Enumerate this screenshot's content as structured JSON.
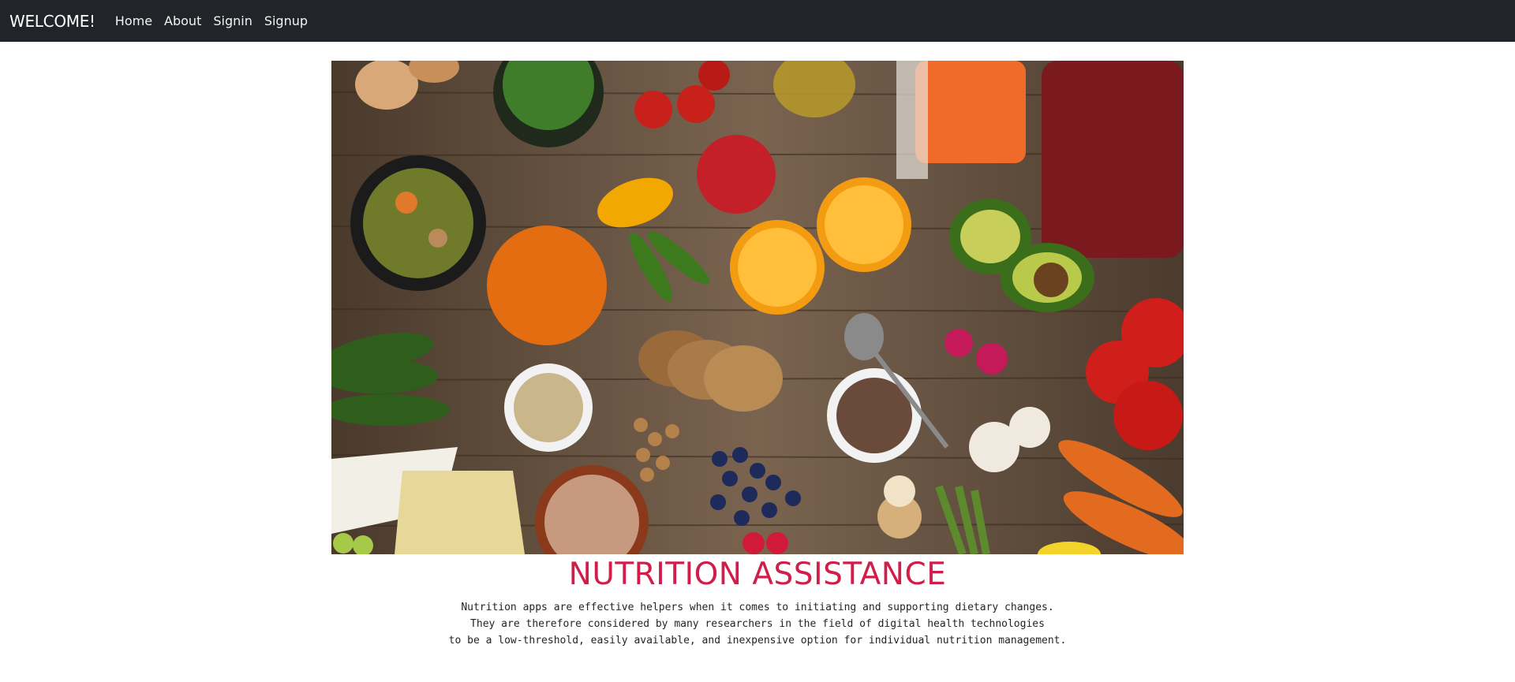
{
  "navbar": {
    "brand": "WELCOME!",
    "links": [
      "Home",
      "About",
      "Signin",
      "Signup"
    ]
  },
  "hero": {
    "image": "food-ingredients-table-photo",
    "title": "NUTRITION ASSISTANCE",
    "description": [
      "Nutrition apps are effective helpers when it comes to initiating and supporting dietary changes.",
      "They are therefore considered by many researchers in the field of digital health technologies",
      "to be a low-threshold, easily available, and inexpensive option for individual nutrition management."
    ]
  },
  "colors": {
    "navbar_bg": "#212529",
    "title": "#d11d4a",
    "text": "#212529"
  }
}
